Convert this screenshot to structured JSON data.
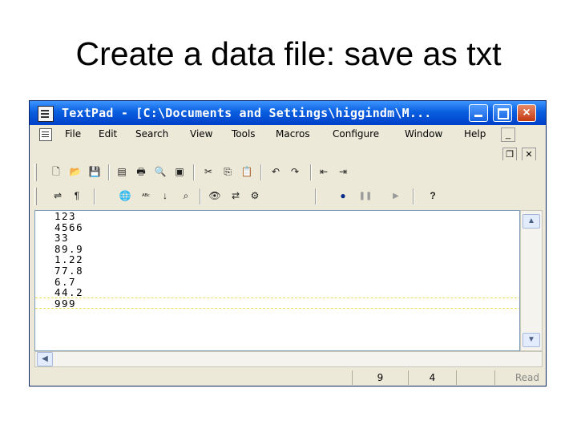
{
  "slide": {
    "title": "Create a data file: save as txt"
  },
  "window": {
    "title": "TextPad - [C:\\Documents and Settings\\higgindm\\M...",
    "buttons": {
      "minimize": "minimize",
      "maximize": "maximize",
      "close": "×"
    }
  },
  "menu": {
    "items": [
      "File",
      "Edit",
      "Search",
      "View",
      "Tools",
      "Macros",
      "Configure",
      "Window",
      "Help"
    ],
    "mdi": {
      "minimize": "_",
      "restore": "❐",
      "close": "✕"
    }
  },
  "toolbar1": {
    "icons": [
      "new-file-icon",
      "open-folder-icon",
      "save-icon",
      "save-all-icon",
      "print-icon",
      "print-preview-icon",
      "manage-files-icon",
      "cut-icon",
      "copy-icon",
      "paste-icon",
      "undo-icon",
      "redo-icon",
      "decrease-indent-icon",
      "increase-indent-icon"
    ],
    "glyphs": [
      "🗋",
      "📂",
      "💾",
      "▤",
      "🖶",
      "🔍",
      "▣",
      "✂",
      "⎘",
      "📋",
      "↶",
      "↷",
      "⇤",
      "⇥"
    ]
  },
  "toolbar2": {
    "icons": [
      "word-wrap-icon",
      "pilcrow-icon",
      "globe-icon",
      "spell-check-icon",
      "sort-icon",
      "find-in-files-icon",
      "find-icon",
      "replace-icon",
      "tools-run-icon",
      "record-macro-icon",
      "pause-macro-icon",
      "play-macro-icon",
      "context-help-icon"
    ],
    "glyphs": [
      "⇌",
      "¶",
      "🌐",
      "ᴬᴮᶜ",
      "↓",
      "⌕",
      "👁",
      "⇄",
      "⚙",
      "●",
      "❚❚",
      "▶",
      "?"
    ]
  },
  "editor": {
    "lines": [
      "123",
      "4566",
      "33",
      "89.9",
      "1.22",
      "77.8",
      "6.7",
      "44.2",
      "999"
    ]
  },
  "status": {
    "line": "9",
    "column": "4",
    "state": "Read"
  }
}
